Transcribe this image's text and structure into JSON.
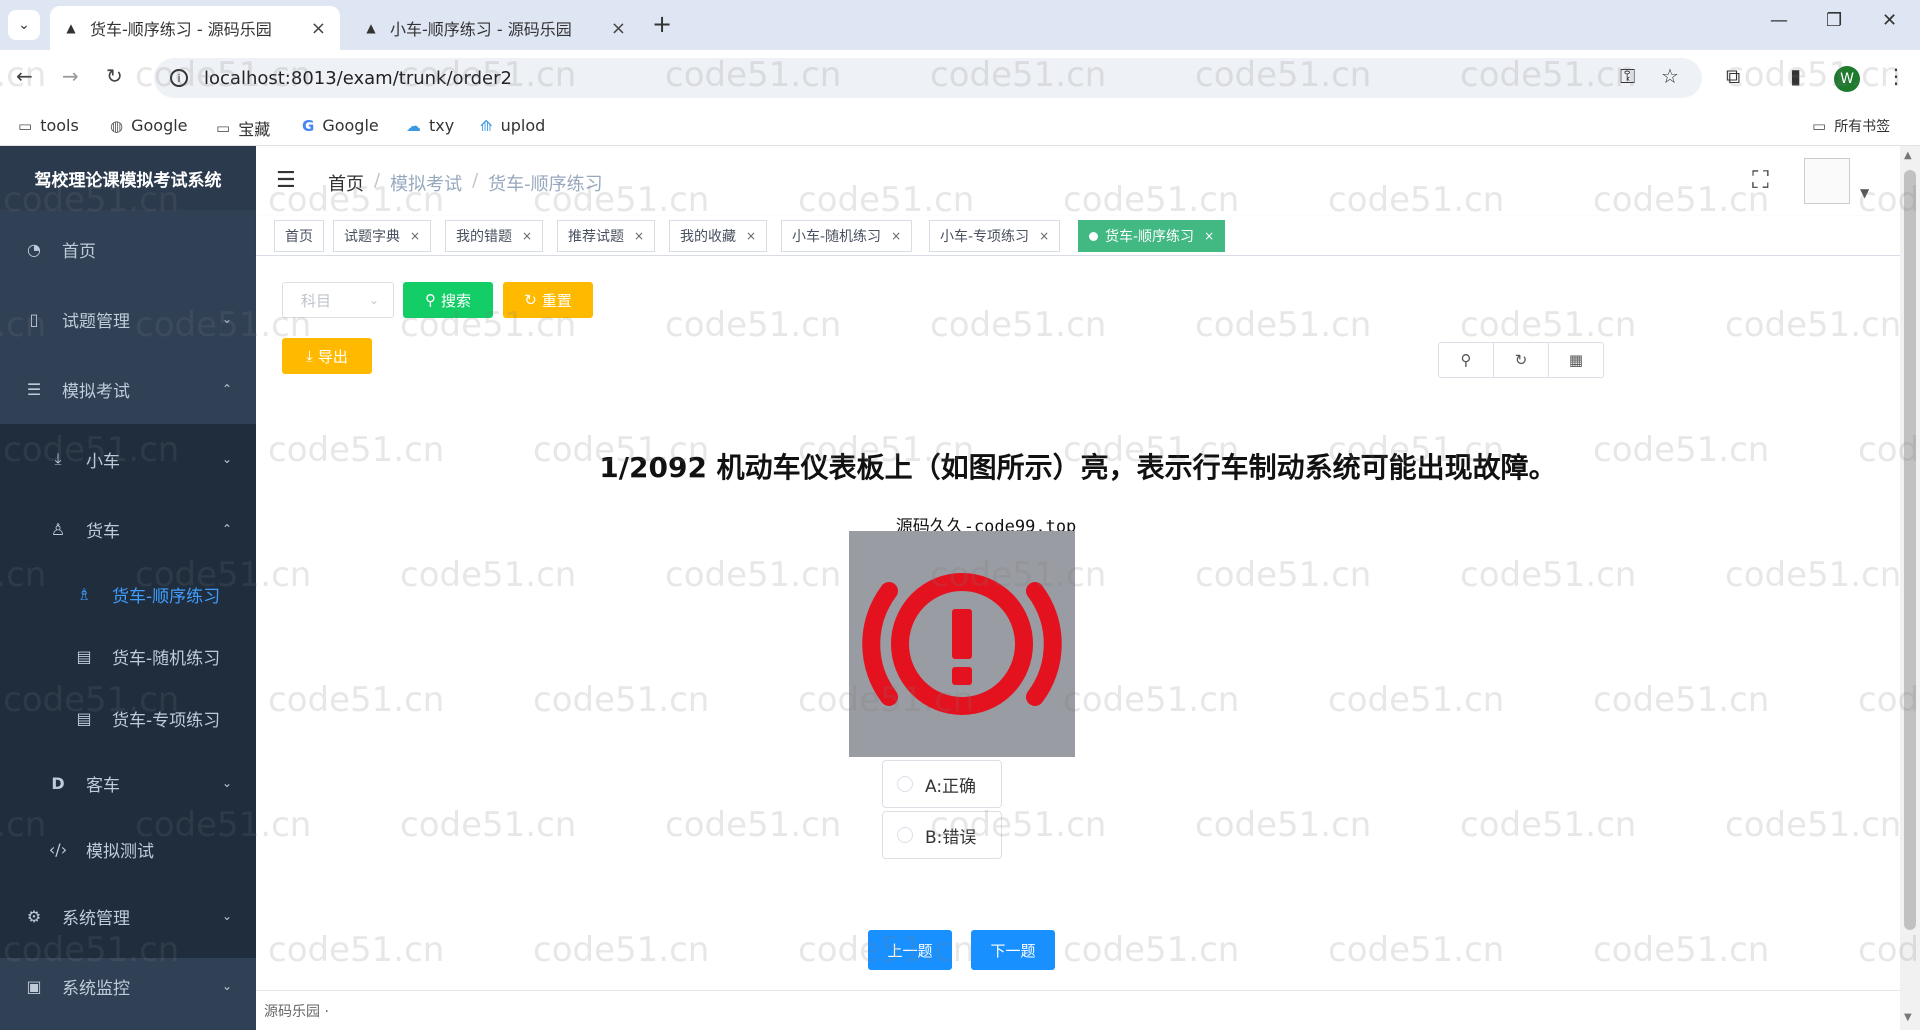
{
  "browser": {
    "tabs": [
      {
        "title": "货车-顺序练习 - 源码乐园",
        "active": true
      },
      {
        "title": "小车-顺序练习 - 源码乐园",
        "active": false
      }
    ],
    "url": "localhost:8013/exam/trunk/order2",
    "avatar_letter": "W",
    "bookmarks": [
      "tools",
      "Google",
      "宝藏",
      "Google",
      "txy",
      "uplod"
    ],
    "all_bookmarks": "所有书签"
  },
  "sidebar": {
    "title": "驾校理论课模拟考试系统",
    "items": [
      {
        "label": "首页",
        "icon": "dashboard-icon"
      },
      {
        "label": "试题管理",
        "icon": "book-icon"
      },
      {
        "label": "模拟考试",
        "icon": "list-icon"
      },
      {
        "label": "小车",
        "icon": "download-icon"
      },
      {
        "label": "货车",
        "icon": "user-icon"
      },
      {
        "label": "货车-顺序练习",
        "icon": "peoples-icon"
      },
      {
        "label": "货车-随机练习",
        "icon": "doc-icon"
      },
      {
        "label": "货车-专项练习",
        "icon": "doc-icon"
      },
      {
        "label": "客车",
        "icon": "d-icon"
      },
      {
        "label": "模拟测试",
        "icon": "code-icon"
      },
      {
        "label": "系统管理",
        "icon": "gear-icon"
      },
      {
        "label": "系统监控",
        "icon": "monitor-icon"
      }
    ]
  },
  "navbar": {
    "breadcrumb": [
      "首页",
      "模拟考试",
      "货车-顺序练习"
    ]
  },
  "tags": [
    {
      "label": "首页",
      "closable": false
    },
    {
      "label": "试题字典",
      "closable": true
    },
    {
      "label": "我的错题",
      "closable": true
    },
    {
      "label": "推荐试题",
      "closable": true
    },
    {
      "label": "我的收藏",
      "closable": true
    },
    {
      "label": "小车-随机练习",
      "closable": true
    },
    {
      "label": "小车-专项练习",
      "closable": true
    },
    {
      "label": "货车-顺序练习",
      "closable": true,
      "active": true
    }
  ],
  "toolbar": {
    "subject_placeholder": "科目",
    "search_label": "搜索",
    "reset_label": "重置",
    "export_label": "导出"
  },
  "question": {
    "text": "1/2092 机动车仪表板上（如图所示）亮，表示行车制动系统可能出现故障。",
    "image_caption": "源码久久-code99.top",
    "options": [
      "A:正确",
      "B:错误"
    ],
    "prev_label": "上一题",
    "next_label": "下一题"
  },
  "footer": {
    "text": "源码乐园 ·"
  },
  "watermark": "code51.cn",
  "colors": {
    "sidebar_bg": "#304156",
    "active_menu": "#409eff",
    "active_tag": "#42b983",
    "btn_green": "#13ce66",
    "btn_orange": "#ffba00",
    "btn_blue": "#1890ff",
    "warning_red": "#e3121e"
  }
}
